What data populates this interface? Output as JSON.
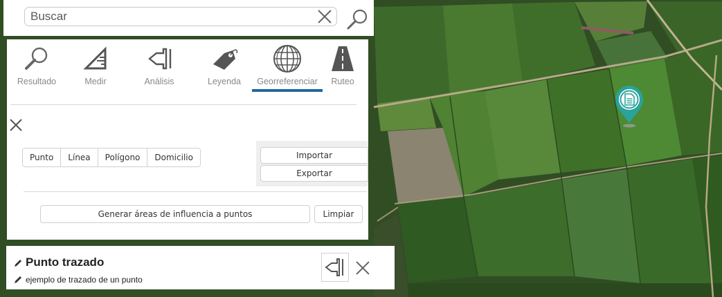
{
  "search": {
    "placeholder": "Buscar"
  },
  "tabs": [
    {
      "label": "Resultado",
      "icon": "magnifier-icon"
    },
    {
      "label": "Medir",
      "icon": "ruler-triangle-icon"
    },
    {
      "label": "Análisis",
      "icon": "analysis-tool-icon"
    },
    {
      "label": "Leyenda",
      "icon": "tag-icon"
    },
    {
      "label": "Georreferenciar",
      "icon": "globe-icon",
      "active": true
    },
    {
      "label": "Ruteo",
      "icon": "road-icon"
    }
  ],
  "geometry_types": [
    "Punto",
    "Línea",
    "Polígono",
    "Domicilio"
  ],
  "io": {
    "import_label": "Importar",
    "export_label": "Exportar"
  },
  "actions": {
    "generate_label": "Generar áreas de influencia a puntos",
    "clear_label": "Limpiar"
  },
  "info": {
    "title": "Punto trazado",
    "subtitle": "ejemplo de trazado de un punto"
  },
  "colors": {
    "accent": "#1f67a0",
    "marker": "#2aa39a",
    "panel_bg": "#ffffff"
  }
}
